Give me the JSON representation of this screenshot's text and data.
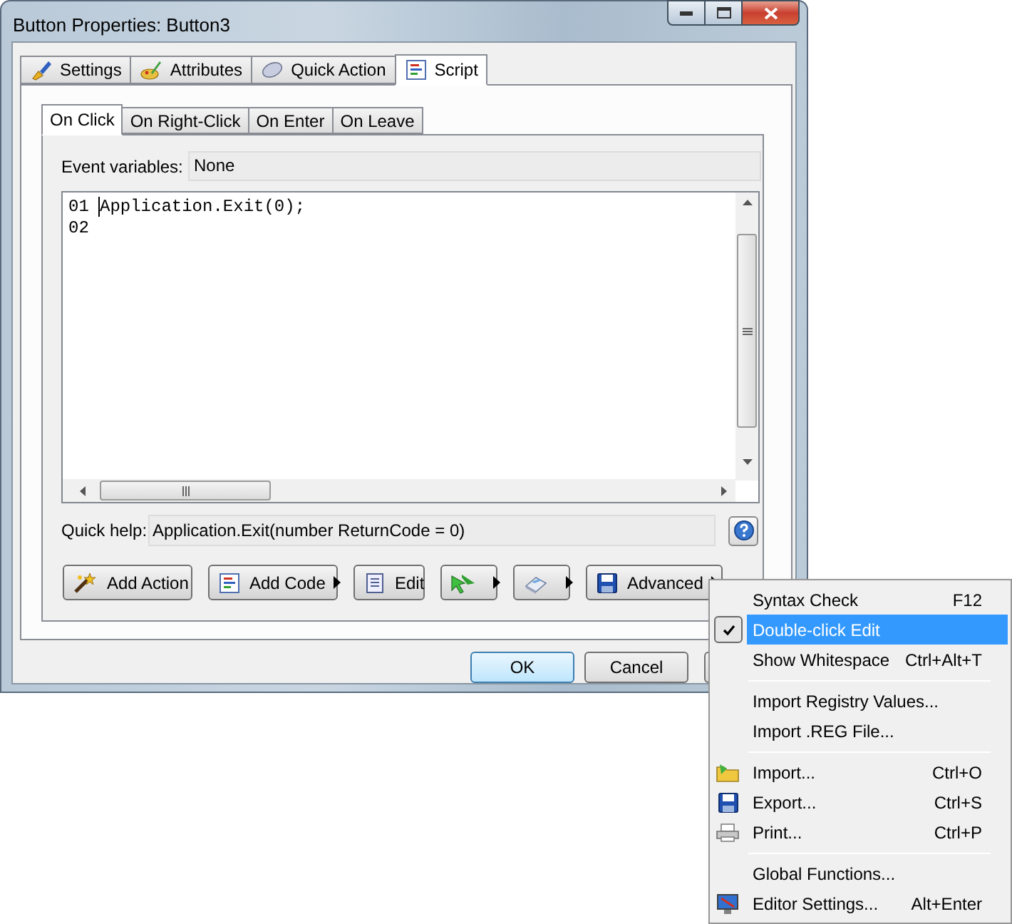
{
  "window": {
    "title": "Button Properties: Button3"
  },
  "tabs": [
    {
      "label": "Settings",
      "selected": false
    },
    {
      "label": "Attributes",
      "selected": false
    },
    {
      "label": "Quick Action",
      "selected": false
    },
    {
      "label": "Script",
      "selected": true
    }
  ],
  "event_tabs": [
    {
      "label": "On Click",
      "selected": true
    },
    {
      "label": "On Right-Click",
      "selected": false
    },
    {
      "label": "On Enter",
      "selected": false
    },
    {
      "label": "On Leave",
      "selected": false
    }
  ],
  "event_variables": {
    "label": "Event variables:",
    "value": "None"
  },
  "editor": {
    "lines": [
      {
        "number": "01",
        "code": "Application.Exit(0);"
      },
      {
        "number": "02"
      }
    ]
  },
  "quick_help": {
    "label": "Quick help:",
    "value": "Application.Exit(number ReturnCode = 0)"
  },
  "tool_buttons": [
    {
      "label": "Add Action",
      "dropdown": false
    },
    {
      "label": "Add Code",
      "dropdown": true
    },
    {
      "label": "Edit",
      "dropdown": false
    },
    {
      "dropdown": true
    },
    {
      "dropdown": true
    },
    {
      "label": "Advanced",
      "dropdown": true
    }
  ],
  "dialog_buttons": [
    {
      "label": "OK",
      "default": true
    },
    {
      "label": "Cancel",
      "default": false
    }
  ],
  "menu": [
    {
      "kind": "item",
      "label": "Syntax Check",
      "shortcut": "F12",
      "checked": false,
      "selected": false
    },
    {
      "kind": "item",
      "label": "Double-click Edit",
      "checked": true,
      "selected": true
    },
    {
      "kind": "item",
      "label": "Show Whitespace",
      "shortcut": "Ctrl+Alt+T",
      "checked": false,
      "selected": false
    },
    {
      "kind": "separator"
    },
    {
      "kind": "item",
      "label": "Import Registry Values...",
      "checked": false,
      "selected": false
    },
    {
      "kind": "item",
      "label": "Import .REG File...",
      "checked": false,
      "selected": false
    },
    {
      "kind": "separator"
    },
    {
      "kind": "item",
      "label": "Import...",
      "shortcut": "Ctrl+O",
      "checked": false,
      "selected": false
    },
    {
      "kind": "item",
      "label": "Export...",
      "shortcut": "Ctrl+S",
      "checked": false,
      "selected": false
    },
    {
      "kind": "item",
      "label": "Print...",
      "shortcut": "Ctrl+P",
      "checked": false,
      "selected": false
    },
    {
      "kind": "separator"
    },
    {
      "kind": "item",
      "label": "Global Functions...",
      "checked": false,
      "selected": false
    },
    {
      "kind": "item",
      "label": "Editor Settings...",
      "shortcut": "Alt+Enter",
      "checked": false,
      "selected": false
    }
  ]
}
